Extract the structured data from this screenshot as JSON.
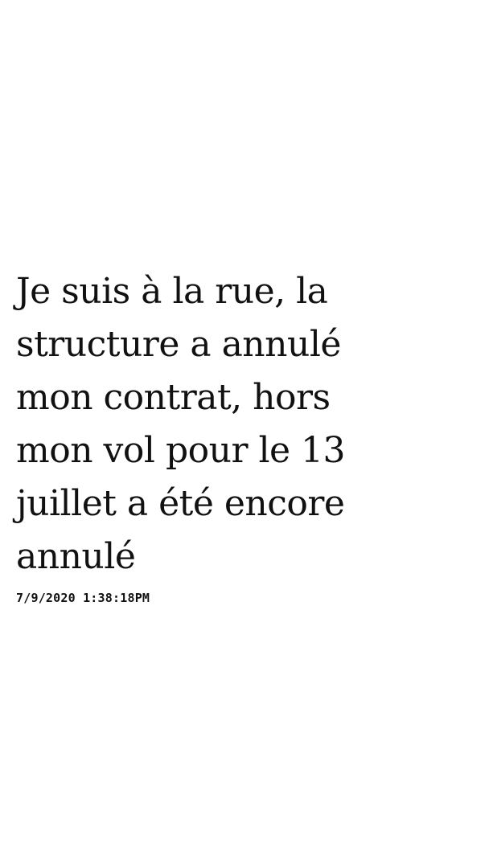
{
  "message": {
    "text": "Je suis à la rue, la\nstructure a annulé\nmon contrat, hors\nmon vol pour le 13\njuillet a été encore\nannulé",
    "timestamp": "7/9/2020 1:38:18PM"
  }
}
